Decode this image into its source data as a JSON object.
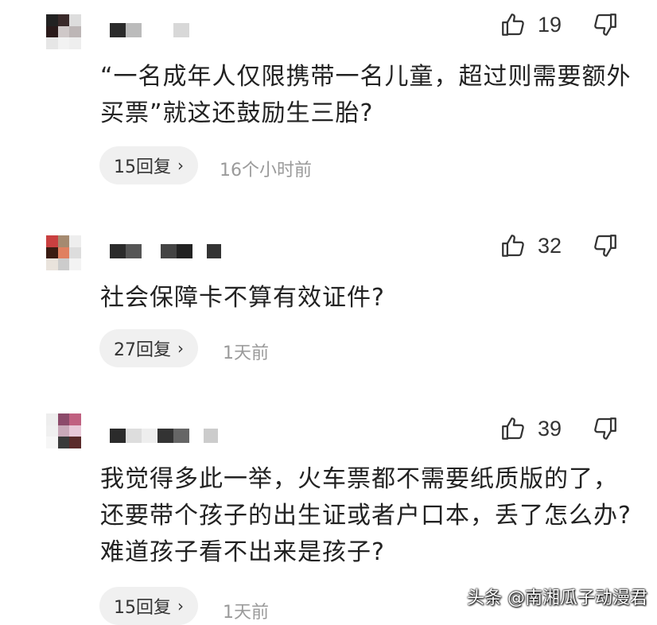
{
  "comments": [
    {
      "likes": "19",
      "text": "“一名成年人仅限携带一名儿童，超过则需要额外买票”就这还鼓励生三胎?",
      "replies": "15回复",
      "time": "16个小时前"
    },
    {
      "likes": "32",
      "text": "社会保障卡不算有效证件?",
      "replies": "27回复",
      "time": "1天前"
    },
    {
      "likes": "39",
      "text": "我觉得多此一举，火车票都不需要纸质版的了，还要带个孩子的出生证或者户口本，丢了怎么办? 难道孩子看不出来是孩子?",
      "replies": "15回复",
      "time": "1天前"
    }
  ],
  "icons": {
    "like": "thumbs-up-icon",
    "dislike": "thumbs-down-icon",
    "reply_arrow": "chevron-right-icon"
  },
  "reply_arrow_glyph": "›",
  "watermark": "头条 @南湘瓜子动漫君",
  "colors": {
    "text": "#222222",
    "time": "#9a9a9a",
    "pill": "#f0f0f0"
  }
}
